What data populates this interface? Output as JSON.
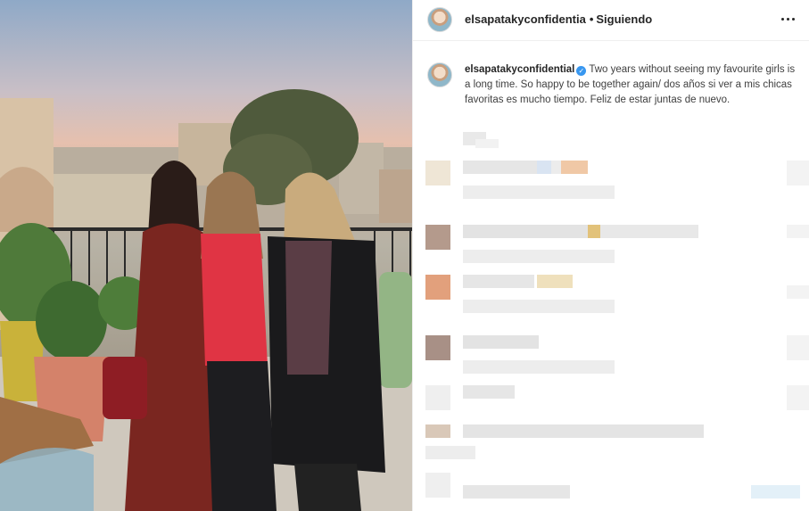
{
  "post": {
    "photo_alt": "Three women posing on a rooftop terrace",
    "header": {
      "username": "elsapatakyconfidentia",
      "separator": "•",
      "follow_status": "Siguiendo",
      "more_icon": "more-horizontal-icon"
    },
    "caption": {
      "username": "elsapatakyconfidential",
      "verified_icon": "verified-badge-icon",
      "text": "Two years without seeing my favourite girls is a long time. So happy to be together again/ dos años si ver a mis chicas favoritas es mucho tiempo. Feliz de estar juntas de nuevo."
    },
    "colors": {
      "accent_blue": "#3897f0",
      "text_primary": "#262626",
      "border": "#efefef"
    }
  }
}
